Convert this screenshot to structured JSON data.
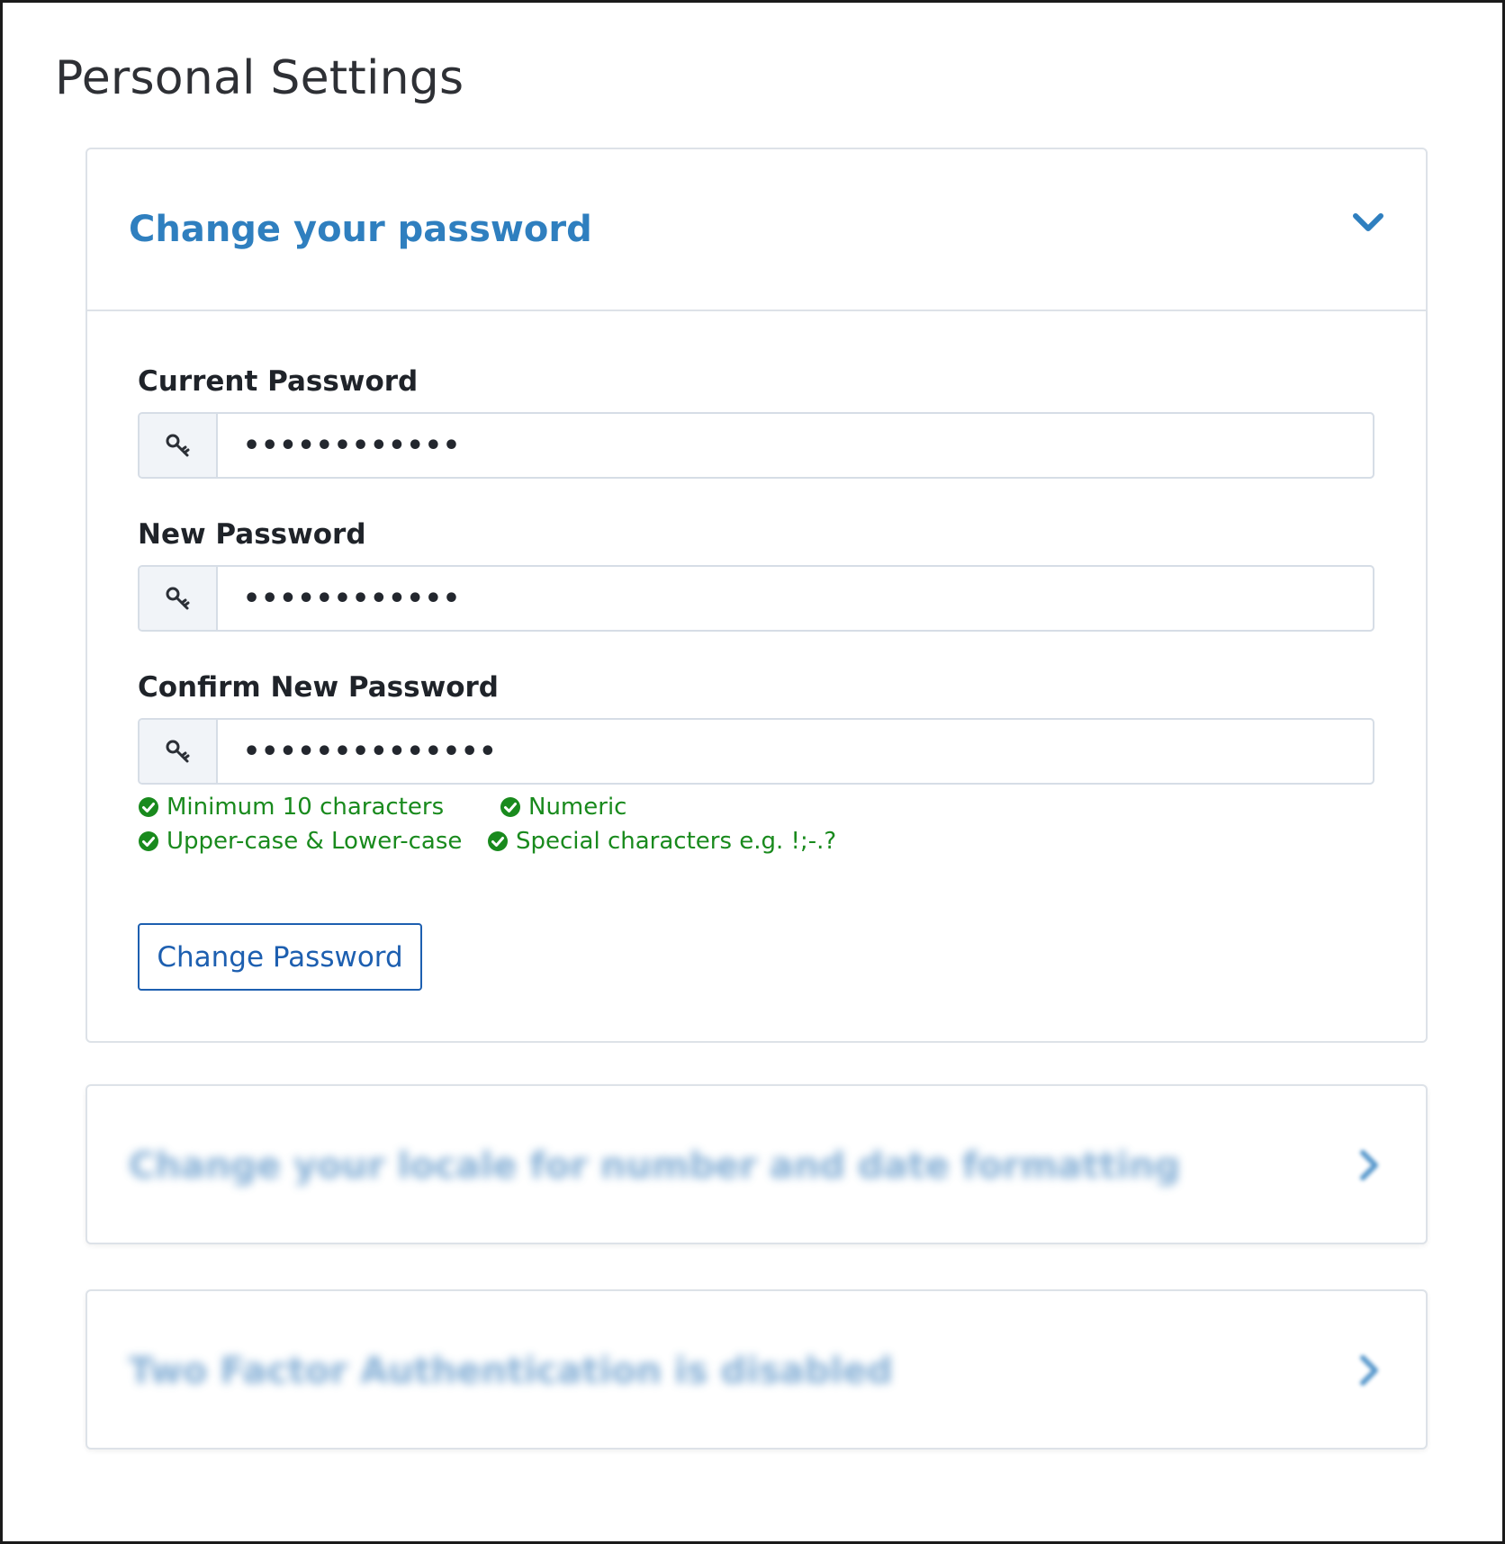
{
  "page": {
    "title": "Personal Settings"
  },
  "password_panel": {
    "title": "Change your password",
    "fields": [
      {
        "label": "Current Password",
        "value": "••••••••••••",
        "icon": "key-icon"
      },
      {
        "label": "New Password",
        "value": "••••••••••••",
        "icon": "key-icon"
      },
      {
        "label": "Confirm New Password",
        "value": "••••••••••••••",
        "icon": "key-icon"
      }
    ],
    "rules": [
      "Minimum 10 characters",
      "Numeric",
      "Upper-case & Lower-case",
      "Special characters e.g. !;-.?"
    ],
    "submit_label": "Change Password"
  },
  "collapsed_panels": [
    {
      "title": "Change your locale for number and date formatting"
    },
    {
      "title": "Two Factor Authentication is disabled"
    }
  ],
  "colors": {
    "accent": "#2f7fbf",
    "button": "#1d5fb0",
    "success": "#198a1d",
    "border": "#dde2e8"
  }
}
